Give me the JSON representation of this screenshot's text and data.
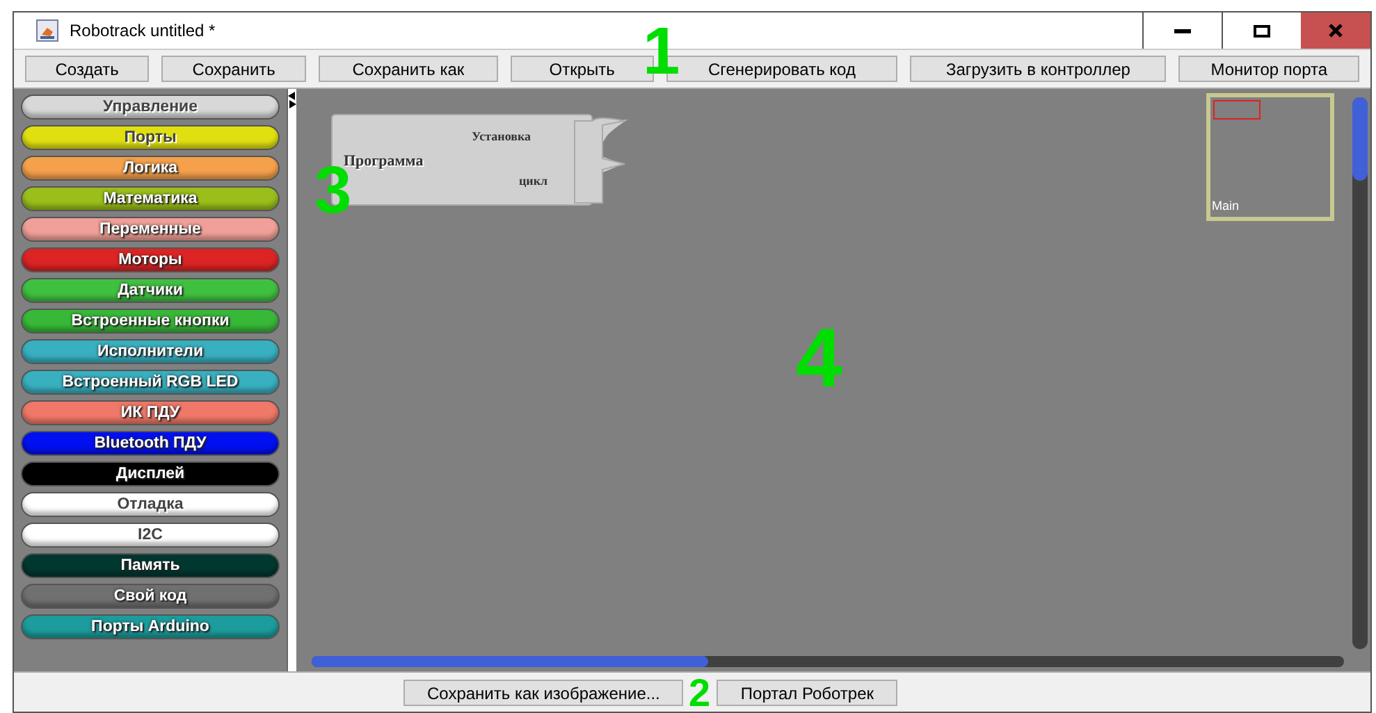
{
  "window": {
    "title": "Robotrack untitled *"
  },
  "toolbar": [
    "Создать",
    "Сохранить",
    "Сохранить как",
    "Открыть",
    "Сгенерировать код",
    "Загрузить в контроллер",
    "Монитор порта"
  ],
  "palette": [
    {
      "label": "Управление",
      "color": "#d8d8d8"
    },
    {
      "label": "Порты",
      "color": "#e0e010"
    },
    {
      "label": "Логика",
      "color": "#f5a04a"
    },
    {
      "label": "Математика",
      "color": "#9abf1a"
    },
    {
      "label": "Переменные",
      "color": "#f0a098"
    },
    {
      "label": "Моторы",
      "color": "#dd2424"
    },
    {
      "label": "Датчики",
      "color": "#40c040"
    },
    {
      "label": "Встроенные кнопки",
      "color": "#38b838"
    },
    {
      "label": "Исполнители",
      "color": "#38b0c0"
    },
    {
      "label": "Встроенный RGB LED",
      "color": "#38b0c0"
    },
    {
      "label": "ИК ПДУ",
      "color": "#f07868"
    },
    {
      "label": "Bluetooth ПДУ",
      "color": "#0010f0"
    },
    {
      "label": "Дисплей",
      "color": "#000000"
    },
    {
      "label": "Отладка",
      "color": "#ffffff"
    },
    {
      "label": "I2C",
      "color": "#ffffff"
    },
    {
      "label": "Память",
      "color": "#003830"
    },
    {
      "label": "Свой код",
      "color": "#707070"
    },
    {
      "label": "Порты Arduino",
      "color": "#1c9c9c"
    }
  ],
  "canvas": {
    "block": {
      "title": "Программа",
      "slots": [
        "Установка",
        "цикл"
      ]
    },
    "minimap": {
      "label": "Main"
    }
  },
  "bottom_buttons": [
    "Сохранить как изображение...",
    "Портал Роботрек"
  ],
  "annotations": [
    "1",
    "2",
    "3",
    "4"
  ]
}
